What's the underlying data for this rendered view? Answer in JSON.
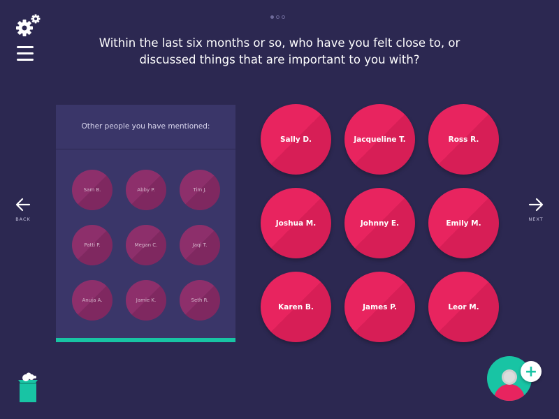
{
  "question": {
    "line1": "Within the last six months or so, who have you felt close to, or",
    "line2": "discussed things that are important to you with?"
  },
  "nav": {
    "back_label": "BACK",
    "next_label": "NEXT"
  },
  "panel": {
    "title": "Other people you have mentioned:",
    "people": [
      "Sam B.",
      "Abby P.",
      "Tim J.",
      "Patti P.",
      "Megan C.",
      "Jaqi T.",
      "Anuja A.",
      "Jamie K.",
      "Seth R."
    ]
  },
  "nominees": [
    "Sally D.",
    "Jacqueline T.",
    "Ross R.",
    "Joshua M.",
    "Johnny E.",
    "Emily M.",
    "Karen B.",
    "James P.",
    "Leor M."
  ],
  "icons": {
    "settings": "gears-icon",
    "menu": "hamburger-menu-icon",
    "back": "arrow-left-icon",
    "next": "arrow-right-icon",
    "delete": "trash-bin-icon",
    "add": "add-person-icon"
  },
  "colors": {
    "background": "#2c2851",
    "panel": "#3a3669",
    "node": "#e8245f",
    "node_muted": "#8d2f6b",
    "accent": "#18c4a4"
  }
}
